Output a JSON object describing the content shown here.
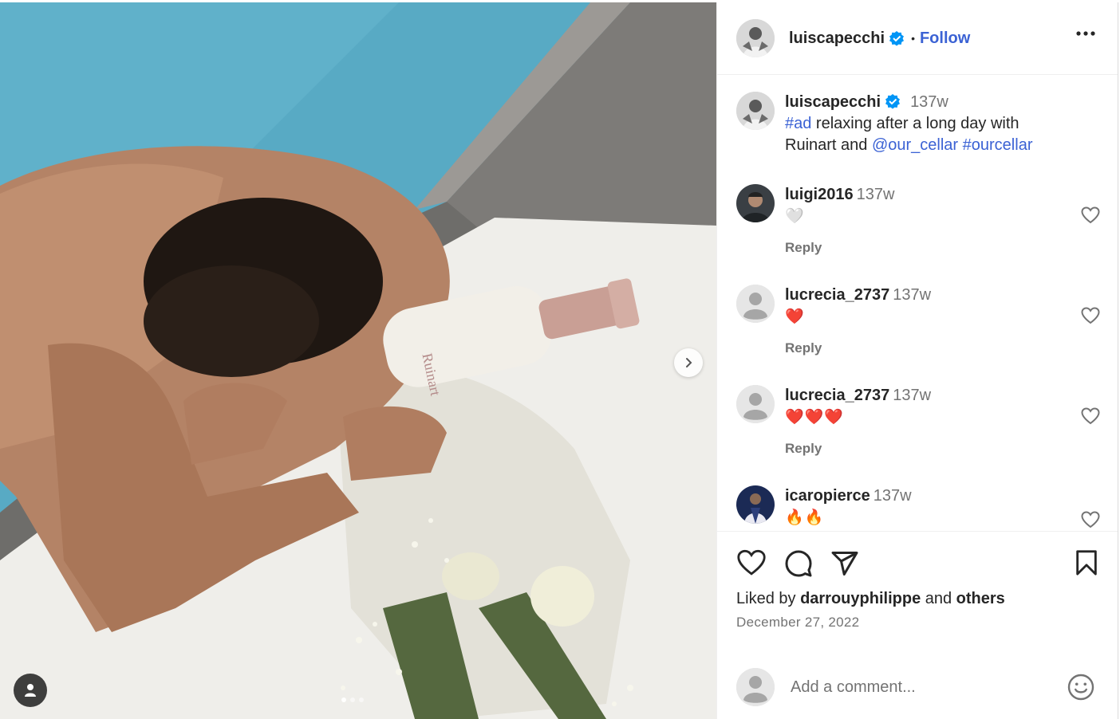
{
  "post": {
    "author": "luiscapecchi",
    "separator": "•",
    "follow_label": "Follow",
    "caption": {
      "time": "137w",
      "hashtag_ad": "#ad",
      "text_1": " relaxing after a long day with Ruinart and ",
      "mention": "@our_cellar",
      "hashtag": "#ourcellar"
    },
    "bottle_brand": "Ruinart"
  },
  "comments": [
    {
      "user": "luigi2016",
      "time": "137w",
      "text": "🤍",
      "reply": "Reply"
    },
    {
      "user": "lucrecia_2737",
      "time": "137w",
      "text": "❤️",
      "reply": "Reply"
    },
    {
      "user": "lucrecia_2737",
      "time": "137w",
      "text": "❤️❤️❤️",
      "reply": "Reply"
    },
    {
      "user": "icaropierce",
      "time": "137w",
      "text": "🔥🔥",
      "reply": ""
    }
  ],
  "footer": {
    "liked_prefix": "Liked by ",
    "liked_user": "darrouyphilippe",
    "liked_and": " and ",
    "liked_others": "others",
    "date": "December 27, 2022",
    "comment_placeholder": "Add a comment..."
  },
  "carousel": {
    "count": 3,
    "active_index": 0
  },
  "colors": {
    "link": "#3b62d4",
    "verified": "#0095f6",
    "muted": "#737373"
  }
}
